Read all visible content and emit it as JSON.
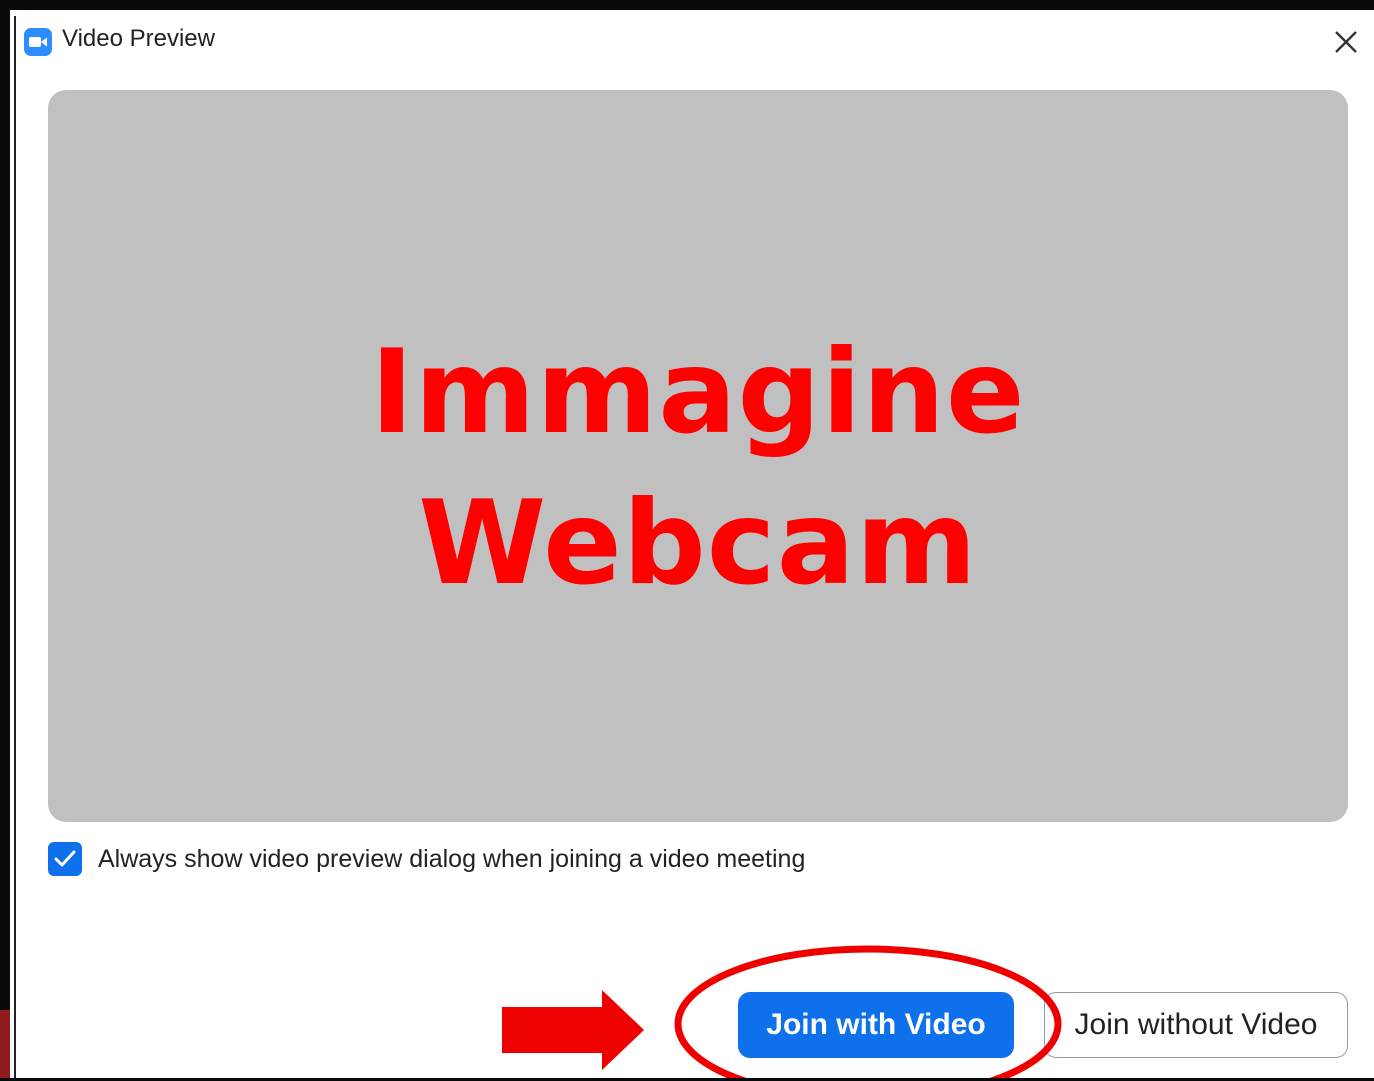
{
  "window": {
    "title": "Video Preview",
    "app_icon": "zoom-camera-icon",
    "close_icon": "close-icon"
  },
  "preview": {
    "overlay_line_1": "Immagine",
    "overlay_line_2": "Webcam",
    "background_color": "#c0c0c0",
    "overlay_color": "#ff0000"
  },
  "options": {
    "always_show_label": "Always show video preview dialog when joining a video meeting",
    "always_show_checked": true
  },
  "buttons": {
    "join_with_video": "Join with Video",
    "join_without_video": "Join without Video"
  },
  "annotations": {
    "arrow_icon": "arrow-right-icon",
    "circle_icon": "highlight-circle",
    "color": "#ee0000"
  },
  "colors": {
    "accent": "#0e71eb",
    "zoom_blue": "#2d8cff"
  }
}
